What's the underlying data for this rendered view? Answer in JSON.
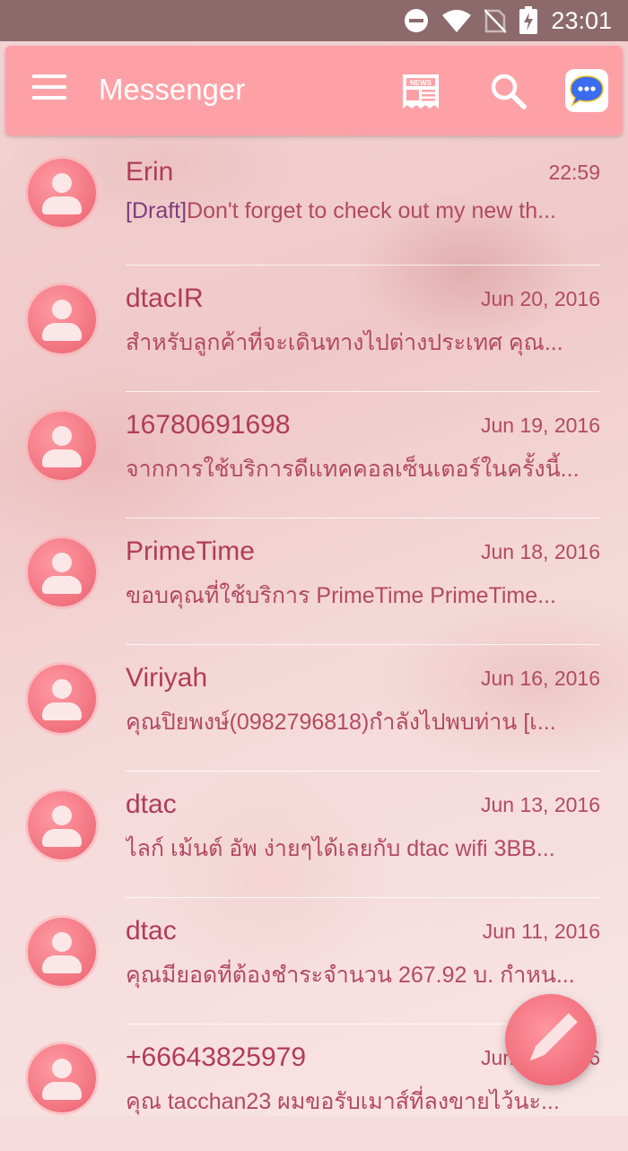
{
  "status_bar": {
    "time": "23:01"
  },
  "app_bar": {
    "title": "Messenger"
  },
  "conversations": [
    {
      "name": "Erin",
      "date": "22:59",
      "draft_prefix": "[Draft]",
      "snippet": "Don't forget to check out my new th..."
    },
    {
      "name": "dtacIR",
      "date": "Jun 20, 2016",
      "snippet": "สำหรับลูกค้าที่จะเดินทางไปต่างประเทศ คุณ..."
    },
    {
      "name": "16780691698",
      "date": "Jun 19, 2016",
      "snippet": "จากการใช้บริการดีแทคคอลเซ็นเตอร์ในครั้งนี้..."
    },
    {
      "name": "PrimeTime",
      "date": "Jun 18, 2016",
      "snippet": "ขอบคุณที่ใช้บริการ PrimeTime PrimeTime..."
    },
    {
      "name": "Viriyah",
      "date": "Jun 16, 2016",
      "snippet": "คุณปิยพงษ์(0982796818)กำลังไปพบท่าน [เ..."
    },
    {
      "name": "dtac",
      "date": "Jun 13, 2016",
      "snippet": "ไลก์ เม้นต์ อัพ ง่ายๆได้เลยกับ dtac wifi 3BB..."
    },
    {
      "name": "dtac",
      "date": "Jun 11, 2016",
      "snippet": "คุณมียอดที่ต้องชำระจำนวน 267.92 บ. กำหน..."
    },
    {
      "name": "+66643825979",
      "date": "Jun 10, 2016",
      "snippet": "คุณ tacchan23 ผมขอรับเมาส์ที่ลงขายไว้นะ..."
    }
  ],
  "icons": {
    "status": [
      "dnd-icon",
      "wifi-icon",
      "no-sim-icon",
      "battery-charging-icon"
    ],
    "app_bar": [
      "menu-icon",
      "news-icon",
      "search-icon",
      "chat-bubble-icon"
    ],
    "fab": "pencil-icon"
  },
  "colors": {
    "app_bar": "#fea1a7",
    "status_bar": "#8c6a6c",
    "name_text": "#b03c5a",
    "draft_label": "#7c3d7c"
  }
}
